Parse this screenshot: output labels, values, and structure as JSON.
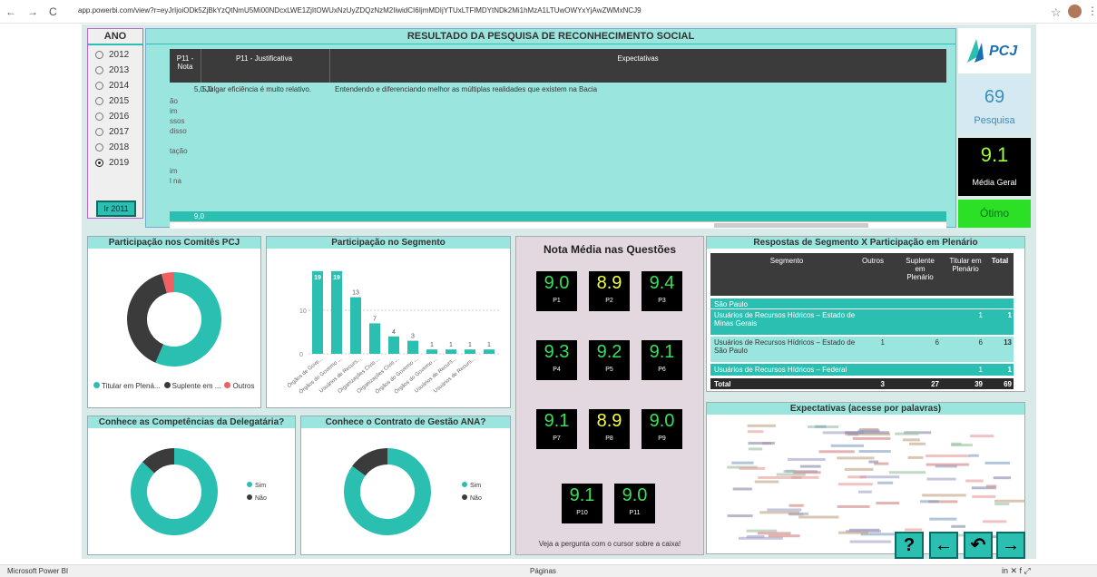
{
  "browser": {
    "url": "app.powerbi.com/view?r=eyJrIjoiODk5ZjBkYzQtNmU5Mi00NDcxLWE1ZjItOWUxNzUyZDQzNzM2IiwidCI6IjmMDIjYTUxLTFlMDYtNDk2Mi1hMzA1LTUwOWYxYjAwZWMxNCJ9",
    "back_icon": "back-arrow-icon",
    "forward_icon": "forward-arrow-icon",
    "reload_icon": "reload-icon"
  },
  "ano": {
    "title": "ANO",
    "years": [
      "2012",
      "2013",
      "2014",
      "2015",
      "2016",
      "2017",
      "2018",
      "2019"
    ],
    "selected": "2019",
    "ir_button": "Ir 2011"
  },
  "resultado": {
    "title": "RESULTADO DA PESQUISA DE RECONHECIMENTO SOCIAL",
    "headers": [
      "P11 - Nota",
      "P11 - Justificativa",
      "Expectativas"
    ],
    "row": {
      "nota": "5,0",
      "justificativa": "Julgar eficiência é muito relativo.",
      "expectativas": "Entendendo e diferenciando melhor as múltiplas realidades que existem na Bacia"
    },
    "left_fragments": [
      "ão",
      "im",
      "ssos",
      "disso",
      "",
      "tação",
      "",
      "im",
      "l na"
    ],
    "total_nota": "9,0"
  },
  "kpis": {
    "pesquisa_value": "69",
    "pesquisa_label": "Pesquisa",
    "media_value": "9.1",
    "media_label": "Média Geral",
    "status": "Ótimo"
  },
  "participacao_comites": {
    "title": "Participação nos Comitês PCJ",
    "legend": [
      "Titular em Plená...",
      "Suplente em ...",
      "Outros"
    ]
  },
  "participacao_segmento": {
    "title": "Participação no Segmento",
    "y_ticks": [
      "0",
      "10"
    ],
    "labels": [
      "19",
      "19",
      "13",
      "7",
      "4",
      "3",
      "1",
      "1",
      "1",
      "1"
    ],
    "categories": [
      "Órgãos de Gove...",
      "Órgãos do Governo ...",
      "Usuários de Recurs...",
      "Organizações Civis ...",
      "Organizações Civis ...",
      "Órgãos do Governo ...",
      "Órgãos do Governo ...",
      "Usuários de Recurs...",
      "Usuários de Recurs...",
      ""
    ]
  },
  "chart_data": [
    {
      "type": "pie",
      "title": "Participação nos Comitês PCJ",
      "categories": [
        "Titular em Plená...",
        "Suplente em ...",
        "Outros"
      ],
      "values": [
        39,
        27,
        3
      ]
    },
    {
      "type": "bar",
      "title": "Participação no Segmento",
      "categories": [
        "Órgãos de Gove...",
        "Órgãos do Governo ...",
        "Usuários de Recurs...",
        "Organizações Civis ...",
        "Organizações Civis ...",
        "Órgãos do Governo ...",
        "Órgãos do Governo ...",
        "Usuários de Recurs...",
        "Usuários de Recurs...",
        ""
      ],
      "values": [
        19,
        19,
        13,
        7,
        4,
        3,
        1,
        1,
        1,
        1
      ],
      "ylim": [
        0,
        20
      ]
    },
    {
      "type": "pie",
      "title": "Conhece as Competências da Delegatária?",
      "categories": [
        "Sim",
        "Não"
      ],
      "values": [
        87,
        13
      ]
    },
    {
      "type": "pie",
      "title": "Conhece o Contrato de Gestão ANA?",
      "categories": [
        "Sim",
        "Não"
      ],
      "values": [
        85,
        15
      ]
    }
  ],
  "nota_media": {
    "title": "Nota Média nas Questões",
    "items": [
      {
        "v": "9.0",
        "p": "P1"
      },
      {
        "v": "8.9",
        "p": "P2"
      },
      {
        "v": "9.4",
        "p": "P3"
      },
      {
        "v": "9.3",
        "p": "P4"
      },
      {
        "v": "9.2",
        "p": "P5"
      },
      {
        "v": "9.1",
        "p": "P6"
      },
      {
        "v": "9.1",
        "p": "P7"
      },
      {
        "v": "8.9",
        "p": "P8"
      },
      {
        "v": "9.0",
        "p": "P9"
      },
      {
        "v": "9.1",
        "p": "P10"
      },
      {
        "v": "9.0",
        "p": "P11"
      }
    ],
    "hint": "Veja a pergunta com o cursor sobre a caixa!"
  },
  "respostas": {
    "title": "Respostas de Segmento X Participação em Plenário",
    "headers": [
      "Segmento",
      "Outros",
      "Suplente em Plenário",
      "Titular em Plenário",
      "Total"
    ],
    "rows": [
      {
        "seg": "São Paulo",
        "outros": "",
        "sup": "",
        "tit": "",
        "tot": ""
      },
      {
        "seg": "Usuários de Recursos Hídricos – Estado de Minas Gerais",
        "outros": "",
        "sup": "",
        "tit": "1",
        "tot": "1"
      },
      {
        "seg": "Usuários de Recursos Hídricos – Estado de São Paulo",
        "outros": "1",
        "sup": "6",
        "tit": "6",
        "tot": "13"
      },
      {
        "seg": "Usuários de Recursos Hídricos – Federal",
        "outros": "",
        "sup": "",
        "tit": "1",
        "tot": "1"
      }
    ],
    "total": {
      "seg": "Total",
      "outros": "3",
      "sup": "27",
      "tit": "39",
      "tot": "69"
    }
  },
  "competencias": {
    "title": "Conhece as Competências da Delegatária?",
    "legend": [
      "Sim",
      "Não"
    ]
  },
  "contrato": {
    "title": "Conhece o Contrato de Gestão ANA?",
    "legend": [
      "Sim",
      "Não"
    ]
  },
  "expectativas": {
    "title": "Expectativas (acesse por palavras)"
  },
  "nav_buttons": [
    "help-icon",
    "left-arrow-icon",
    "undo-icon",
    "right-arrow-icon"
  ],
  "statusbar": {
    "left": "Microsoft Power BI",
    "center": "Páginas"
  },
  "colors": {
    "teal": "#2bbfb2",
    "dark": "#3b3b3b",
    "red": "#f06060"
  }
}
